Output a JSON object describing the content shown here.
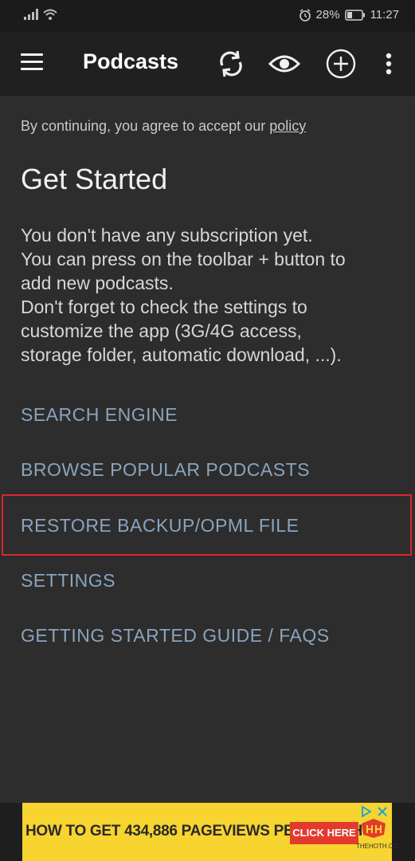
{
  "status_bar": {
    "battery": "28%",
    "time": "11:27",
    "icons": [
      "signal-icon",
      "wifi-icon",
      "alarm-icon",
      "battery-icon"
    ]
  },
  "toolbar": {
    "title": "Podcasts",
    "icons": [
      "menu-icon",
      "refresh-icon",
      "eye-icon",
      "add-circle-icon",
      "more-vert-icon"
    ]
  },
  "intro": {
    "policy_prefix": "By continuing, you agree to accept our ",
    "policy_link": "policy",
    "heading": "Get Started",
    "description_lines": [
      "You don't have any subscription yet.",
      "You can press on the toolbar + button to",
      "add new podcasts.",
      "Don't forget to check the settings to",
      "customize the app (3G/4G access,",
      "storage folder, automatic download, ...)."
    ]
  },
  "actions": {
    "search": "SEARCH ENGINE",
    "browse": "BROWSE POPULAR PODCASTS",
    "restore": "RESTORE BACKUP/OPML FILE",
    "settings": "SETTINGS",
    "guide": "GETTING STARTED GUIDE  /  FAQS"
  },
  "ad": {
    "headline": "HOW TO GET 434,886 PAGEVIEWS PER MONTH",
    "cta": "CLICK HERE",
    "brand": "THEHOTH.CO"
  },
  "colors": {
    "background": "#2d2d2d",
    "toolbar": "#202020",
    "status_bar": "#1b1b1b",
    "link": "#8aa4be",
    "highlight": "#d9272e",
    "ad_background": "#f7d430",
    "ad_button": "#e23b2e"
  }
}
